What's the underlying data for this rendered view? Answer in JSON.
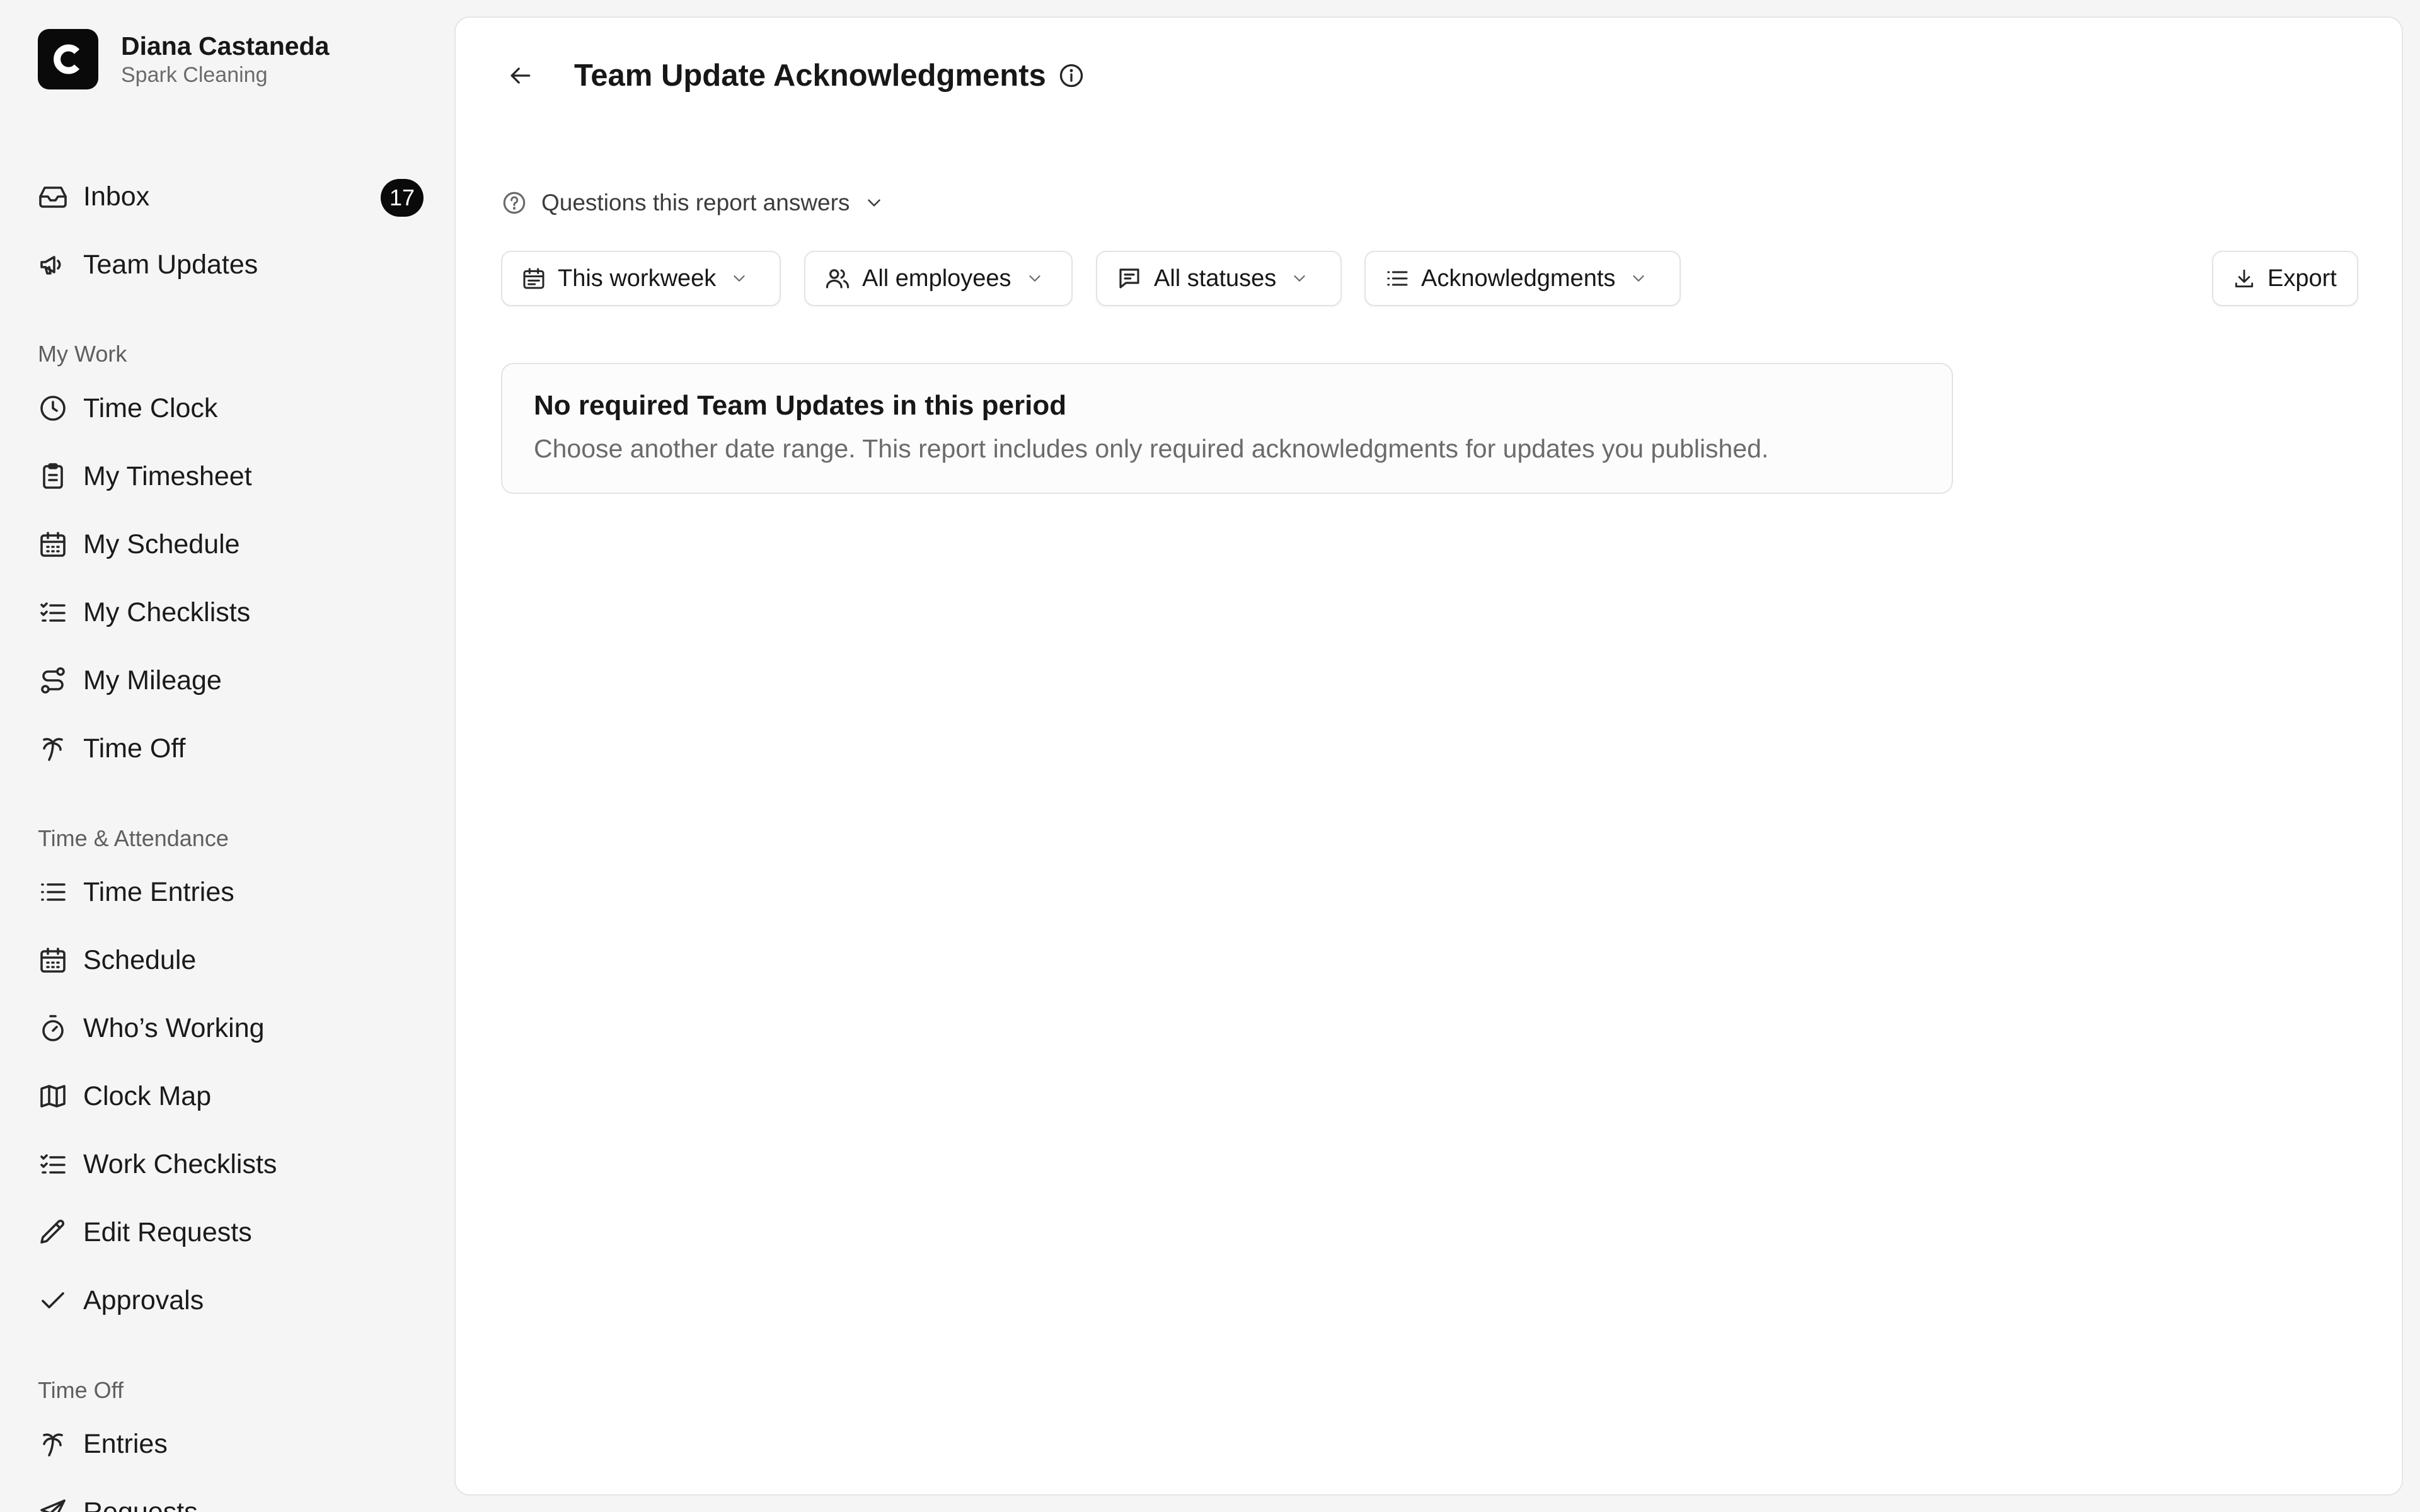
{
  "user": {
    "name": "Diana Castaneda",
    "org": "Spark Cleaning",
    "logo_letter": "C"
  },
  "nav": {
    "inbox": {
      "label": "Inbox",
      "badge": "17",
      "icon": "inbox-icon"
    },
    "team_updates": {
      "label": "Team Updates",
      "icon": "megaphone-icon"
    },
    "sections": {
      "my_work": "My Work",
      "time_attendance": "Time & Attendance",
      "time_off": "Time Off"
    },
    "my_work": [
      {
        "label": "Time Clock",
        "icon": "clock-icon"
      },
      {
        "label": "My Timesheet",
        "icon": "clipboard-icon"
      },
      {
        "label": "My Schedule",
        "icon": "calendar-icon"
      },
      {
        "label": "My Checklists",
        "icon": "checklist-icon"
      },
      {
        "label": "My Mileage",
        "icon": "route-icon"
      },
      {
        "label": "Time Off",
        "icon": "palm-tree-icon"
      }
    ],
    "time_attendance": [
      {
        "label": "Time Entries",
        "icon": "list-icon"
      },
      {
        "label": "Schedule",
        "icon": "calendar-icon"
      },
      {
        "label": "Who’s Working",
        "icon": "stopwatch-icon"
      },
      {
        "label": "Clock Map",
        "icon": "map-icon"
      },
      {
        "label": "Work Checklists",
        "icon": "checklist-icon"
      },
      {
        "label": "Edit Requests",
        "icon": "pencil-icon"
      },
      {
        "label": "Approvals",
        "icon": "check-icon"
      }
    ],
    "time_off": [
      {
        "label": "Entries",
        "icon": "palm-tree-icon"
      },
      {
        "label": "Requests",
        "icon": "send-icon"
      }
    ]
  },
  "page": {
    "title": "Team Update Acknowledgments",
    "questions_label": "Questions this report answers",
    "filters": {
      "period": "This workweek",
      "employees": "All employees",
      "statuses": "All statuses",
      "view": "Acknowledgments"
    },
    "export_label": "Export",
    "empty": {
      "title": "No required Team Updates in this period",
      "body": "Choose another date range. This report includes only required acknowledgments for updates you published."
    }
  },
  "colors": {
    "accent": "#0a0a0a",
    "panel": "#ffffff",
    "background": "#f5f5f5",
    "muted_text": "#6b6b6b"
  }
}
